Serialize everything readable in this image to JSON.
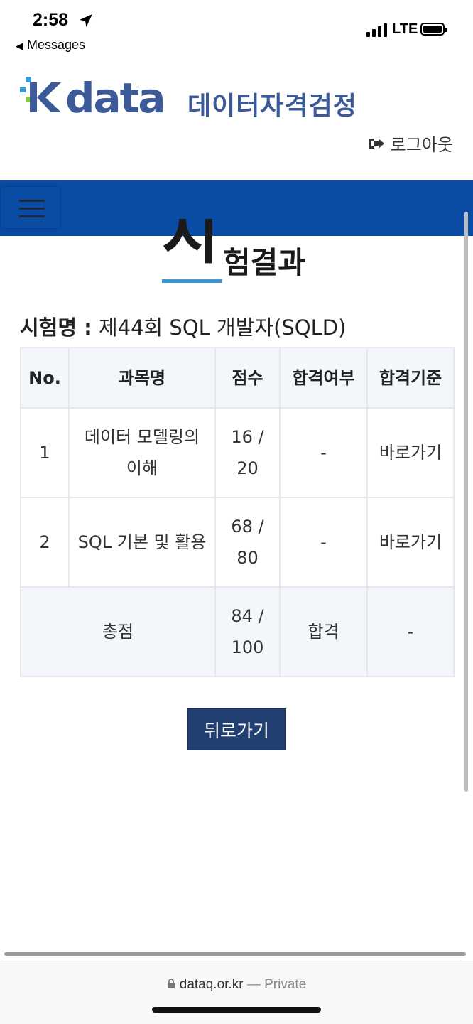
{
  "status_bar": {
    "time": "2:58",
    "back_app": "Messages",
    "network": "LTE",
    "icons": [
      "location-arrow-icon",
      "signal-icon",
      "battery-icon"
    ]
  },
  "header": {
    "logo_text": "Kdata",
    "logo_subtitle": "데이터자격검정",
    "logout_label": "로그아웃",
    "logout_icon": "sign-out-icon"
  },
  "colors": {
    "navbar": "#0a4ba3",
    "accent_underline": "#3a9bd6",
    "button": "#223f72",
    "logo_blue": "#3d5a98",
    "logo_green": "#8cc63f"
  },
  "page": {
    "title_first": "시",
    "title_rest": "험결과",
    "exam_label": "시험명 :",
    "exam_name": "제44회 SQL 개발자(SQLD)"
  },
  "table": {
    "headers": [
      "No.",
      "과목명",
      "점수",
      "합격여부",
      "합격기준"
    ],
    "rows": [
      {
        "no": "1",
        "subject": "데이터 모델링의 이해",
        "score": "16 / 20",
        "pass": "-",
        "criteria": "바로가기"
      },
      {
        "no": "2",
        "subject": "SQL 기본 및 활용",
        "score": "68 / 80",
        "pass": "-",
        "criteria": "바로가기"
      }
    ],
    "total": {
      "label": "총점",
      "score": "84 / 100",
      "pass": "합격",
      "criteria": "-"
    }
  },
  "actions": {
    "back_label": "뒤로가기"
  },
  "browser": {
    "domain": "dataq.or.kr",
    "separator": "—",
    "mode": "Private",
    "lock_icon": "lock-icon"
  }
}
